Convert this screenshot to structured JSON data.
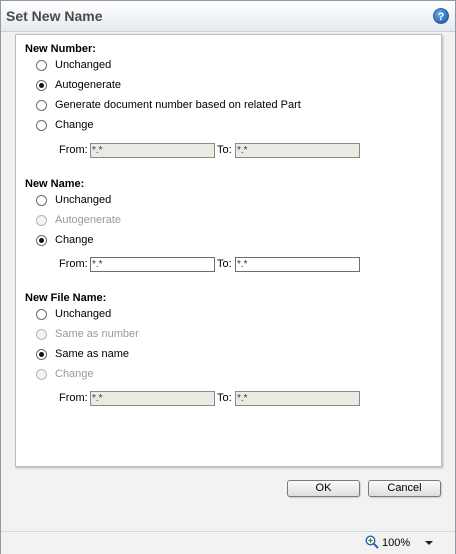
{
  "window": {
    "title": "Set New Name",
    "help_icon": "help-icon"
  },
  "new_number": {
    "label": "New Number:",
    "options": [
      {
        "label": "Unchanged",
        "checked": false,
        "disabled": false
      },
      {
        "label": "Autogenerate",
        "checked": true,
        "disabled": false
      },
      {
        "label": "Generate document number based on related Part",
        "checked": false,
        "disabled": false
      },
      {
        "label": "Change",
        "checked": false,
        "disabled": false
      }
    ],
    "from_label": "From:",
    "from_value": "*.*",
    "to_label": "To:",
    "to_value": "*.*"
  },
  "new_name": {
    "label": "New Name:",
    "options": [
      {
        "label": "Unchanged",
        "checked": false,
        "disabled": false
      },
      {
        "label": "Autogenerate",
        "checked": false,
        "disabled": true
      },
      {
        "label": "Change",
        "checked": true,
        "disabled": false
      }
    ],
    "from_label": "From:",
    "from_value": "*.*",
    "to_label": "To:",
    "to_value": "*.*"
  },
  "new_file_name": {
    "label": "New File Name:",
    "options": [
      {
        "label": "Unchanged",
        "checked": false,
        "disabled": false
      },
      {
        "label": "Same as number",
        "checked": false,
        "disabled": true
      },
      {
        "label": "Same as name",
        "checked": true,
        "disabled": false
      },
      {
        "label": "Change",
        "checked": false,
        "disabled": true
      }
    ],
    "from_label": "From:",
    "from_value": "*.*",
    "to_label": "To:",
    "to_value": "*.*"
  },
  "buttons": {
    "ok": "OK",
    "cancel": "Cancel"
  },
  "status": {
    "zoom": "100%",
    "zoom_icon": "zoom-icon"
  }
}
